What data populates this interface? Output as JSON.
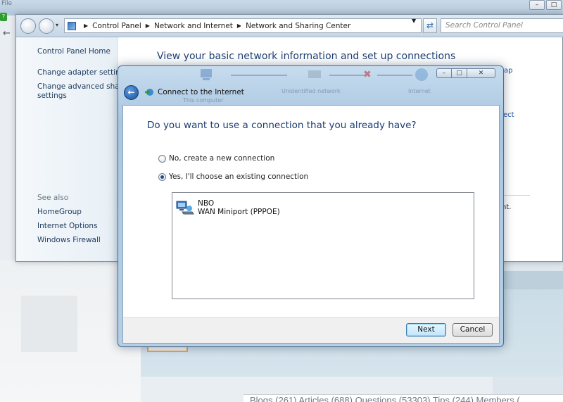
{
  "background": {
    "file_menu": "File",
    "bottom_links": "Blogs (261)   Articles (688)   Questions (53303)   Tips (244)   Members (..."
  },
  "window": {
    "breadcrumbs": [
      "Control Panel",
      "Network and Internet",
      "Network and Sharing Center"
    ],
    "search_placeholder": "Search Control Panel",
    "sidebar": {
      "home": "Control Panel Home",
      "change_adapter": "Change adapter settings",
      "change_advanced_1": "Change advanced sharin",
      "change_advanced_2": "settings",
      "see_also": "See also",
      "homegroup": "HomeGroup",
      "internet_options": "Internet Options",
      "windows_firewall": "Windows Firewall"
    },
    "heading": "View your basic network information and set up connections",
    "fragments": {
      "map": "ap",
      "connect": "ect",
      "nt": "nt."
    }
  },
  "dialog": {
    "title": "Connect to the Internet",
    "ghost_labels": [
      "This computer",
      "Unidentified network",
      "Internet"
    ],
    "question": "Do you want to use a connection that you already have?",
    "option_new": "No, create a new connection",
    "option_existing": "Yes, I'll choose an existing connection",
    "selected_option": "existing",
    "connections": [
      {
        "name": "NBO",
        "type": "WAN Miniport (PPPOE)"
      }
    ],
    "next_label": "Next",
    "cancel_label": "Cancel"
  },
  "colors": {
    "heading_blue": "#1e3f75",
    "dialog_frame": "#b5cfe7",
    "accent_button": "#bee6fd"
  },
  "icons": [
    "back-arrow-icon",
    "forward-arrow-icon",
    "control-panel-icon",
    "refresh-icon",
    "network-connect-icon",
    "network-adapter-icon",
    "minimize-icon",
    "maximize-icon",
    "close-icon"
  ]
}
